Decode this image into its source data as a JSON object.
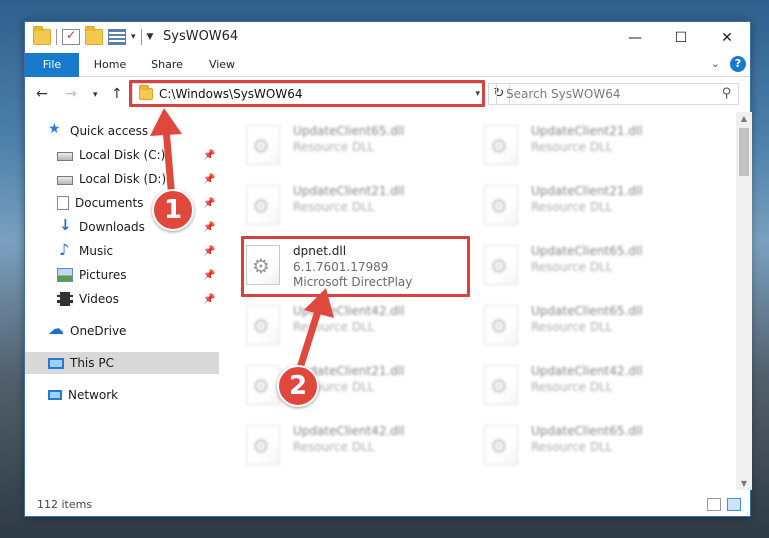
{
  "window": {
    "title": "SysWOW64",
    "controls": {
      "minimize": "—",
      "maximize": "☐",
      "close": "✕"
    }
  },
  "ribbon": {
    "tabs": [
      "File",
      "Home",
      "Share",
      "View"
    ],
    "help": "?"
  },
  "navigation": {
    "address_path": "C:\\Windows\\SysWOW64",
    "search_placeholder": "Search SysWOW64"
  },
  "sidebar": {
    "quick_access": "Quick access",
    "items": [
      {
        "label": "Local Disk (C:)",
        "icon": "drive-icon",
        "pinned": true
      },
      {
        "label": "Local Disk (D:)",
        "icon": "drive-icon",
        "pinned": true
      },
      {
        "label": "Documents",
        "icon": "documents-icon",
        "pinned": true
      },
      {
        "label": "Downloads",
        "icon": "downloads-icon",
        "pinned": true
      },
      {
        "label": "Music",
        "icon": "music-icon",
        "pinned": true
      },
      {
        "label": "Pictures",
        "icon": "pictures-icon",
        "pinned": true
      },
      {
        "label": "Videos",
        "icon": "videos-icon",
        "pinned": true
      }
    ],
    "onedrive": "OneDrive",
    "this_pc": "This PC",
    "network": "Network"
  },
  "files": {
    "featured": {
      "name": "dpnet.dll",
      "version": "6.1.7601.17989",
      "description": "Microsoft DirectPlay"
    },
    "blurred": [
      {
        "name": "UpdateClient65.dll",
        "type": "Resource DLL"
      },
      {
        "name": "UpdateClient21.dll",
        "type": "Resource DLL"
      },
      {
        "name": "UpdateClient21.dll",
        "type": "Resource DLL"
      },
      {
        "name": "UpdateClient21.dll",
        "type": "Resource DLL"
      },
      {
        "name": "UpdateClient65.dll",
        "type": "Resource DLL"
      },
      {
        "name": "UpdateClient42.dll",
        "type": "Resource DLL"
      },
      {
        "name": "UpdateClient65.dll",
        "type": "Resource DLL"
      },
      {
        "name": "UpdateClient21.dll",
        "type": "Resource DLL"
      },
      {
        "name": "UpdateClient42.dll",
        "type": "Resource DLL"
      },
      {
        "name": "UpdateClient42.dll",
        "type": "Resource DLL"
      },
      {
        "name": "UpdateClient65.dll",
        "type": "Resource DLL"
      }
    ]
  },
  "status": {
    "item_count": "112 items"
  },
  "callouts": {
    "step1": "1",
    "step2": "2",
    "color": "#e0483e"
  }
}
